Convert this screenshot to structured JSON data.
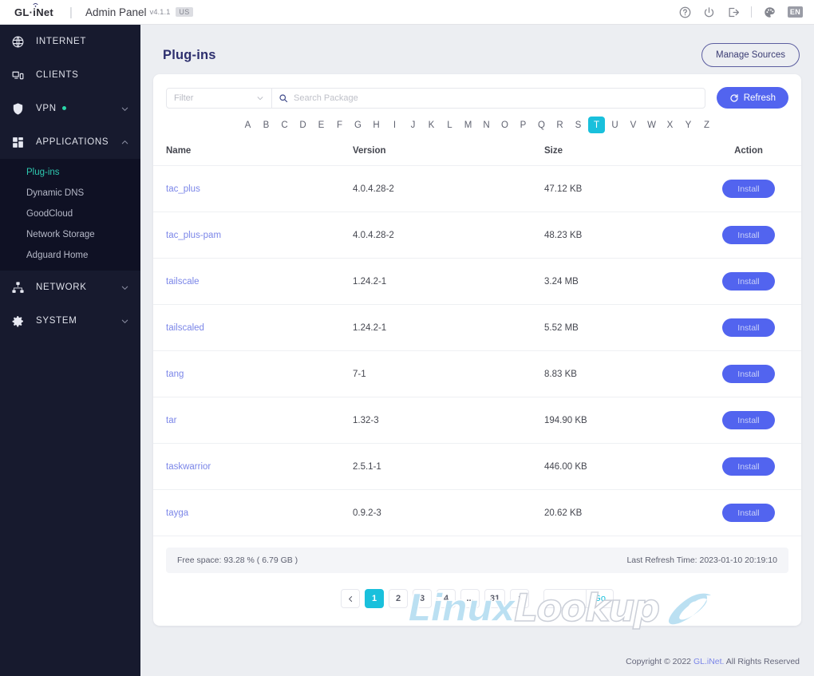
{
  "topbar": {
    "brand": "GL·iNet",
    "brand_icon": "wifi-signal-icon",
    "app_title": "Admin Panel",
    "version": "v4.1.1",
    "region_badge": "US",
    "icons": [
      {
        "name": "help-icon",
        "label": "Help"
      },
      {
        "name": "power-icon",
        "label": "Power"
      },
      {
        "name": "logout-icon",
        "label": "Log out"
      },
      {
        "name": "theme-palette-icon",
        "label": "Theme"
      }
    ],
    "language": "EN"
  },
  "sidebar": {
    "groups": [
      {
        "label": "INTERNET",
        "icon": "globe-icon",
        "expandable": false,
        "dot": false
      },
      {
        "label": "CLIENTS",
        "icon": "devices-icon",
        "expandable": false,
        "dot": false
      },
      {
        "label": "VPN",
        "icon": "shield-icon",
        "expandable": true,
        "dot": true,
        "expanded": false
      },
      {
        "label": "APPLICATIONS",
        "icon": "grid-apps-icon",
        "expandable": true,
        "dot": false,
        "expanded": true,
        "items": [
          {
            "label": "Plug-ins",
            "active": true
          },
          {
            "label": "Dynamic DNS",
            "active": false
          },
          {
            "label": "GoodCloud",
            "active": false
          },
          {
            "label": "Network Storage",
            "active": false
          },
          {
            "label": "Adguard Home",
            "active": false
          }
        ]
      },
      {
        "label": "NETWORK",
        "icon": "network-tree-icon",
        "expandable": true,
        "dot": false,
        "expanded": false
      },
      {
        "label": "SYSTEM",
        "icon": "gear-icon",
        "expandable": true,
        "dot": false,
        "expanded": false
      }
    ]
  },
  "page": {
    "title": "Plug-ins",
    "manage_sources_label": "Manage Sources"
  },
  "toolbar": {
    "filter_placeholder": "Filter",
    "filter_value": "",
    "search_placeholder": "Search Package",
    "search_value": "",
    "refresh_label": "Refresh"
  },
  "alphabet": {
    "letters": [
      "A",
      "B",
      "C",
      "D",
      "E",
      "F",
      "G",
      "H",
      "I",
      "J",
      "K",
      "L",
      "M",
      "N",
      "O",
      "P",
      "Q",
      "R",
      "S",
      "T",
      "U",
      "V",
      "W",
      "X",
      "Y",
      "Z"
    ],
    "selected": "T"
  },
  "table": {
    "columns": [
      "Name",
      "Version",
      "Size",
      "Action"
    ],
    "action_label": "Install",
    "rows": [
      {
        "name": "tac_plus",
        "version": "4.0.4.28-2",
        "size": "47.12 KB",
        "action": "Install"
      },
      {
        "name": "tac_plus-pam",
        "version": "4.0.4.28-2",
        "size": "48.23 KB",
        "action": "Install"
      },
      {
        "name": "tailscale",
        "version": "1.24.2-1",
        "size": "3.24 MB",
        "action": "Install"
      },
      {
        "name": "tailscaled",
        "version": "1.24.2-1",
        "size": "5.52 MB",
        "action": "Install"
      },
      {
        "name": "tang",
        "version": "7-1",
        "size": "8.83 KB",
        "action": "Install"
      },
      {
        "name": "tar",
        "version": "1.32-3",
        "size": "194.90 KB",
        "action": "Install"
      },
      {
        "name": "taskwarrior",
        "version": "2.5.1-1",
        "size": "446.00 KB",
        "action": "Install"
      },
      {
        "name": "tayga",
        "version": "0.9.2-3",
        "size": "20.62 KB",
        "action": "Install"
      }
    ]
  },
  "status": {
    "free_space": "Free space: 93.28 % ( 6.79 GB )",
    "last_refresh": "Last Refresh Time: 2023-01-10 20:19:10"
  },
  "pagination": {
    "prev": "‹",
    "next": "›",
    "pages": [
      "1",
      "2",
      "3",
      "4",
      "...",
      "31"
    ],
    "current": "1",
    "jump_value": "",
    "go_label": "Go"
  },
  "watermark": {
    "text_a": "Linux",
    "text_b": "Lookup",
    "icon": "eye-swoosh-icon"
  },
  "footer": {
    "copyright_prefix": "Copyright © 2022 ",
    "brand_link": "GL.iNet.",
    "copyright_suffix": " All Rights Reserved"
  },
  "colors": {
    "accent_cyan": "#19c0dc",
    "accent_blue": "#5264ef",
    "sidebar_bg": "#171a2e",
    "sidebar_active_teal": "#2ec9b0",
    "title_navy": "#2d2f6e",
    "link_violet": "#7b86e8"
  }
}
